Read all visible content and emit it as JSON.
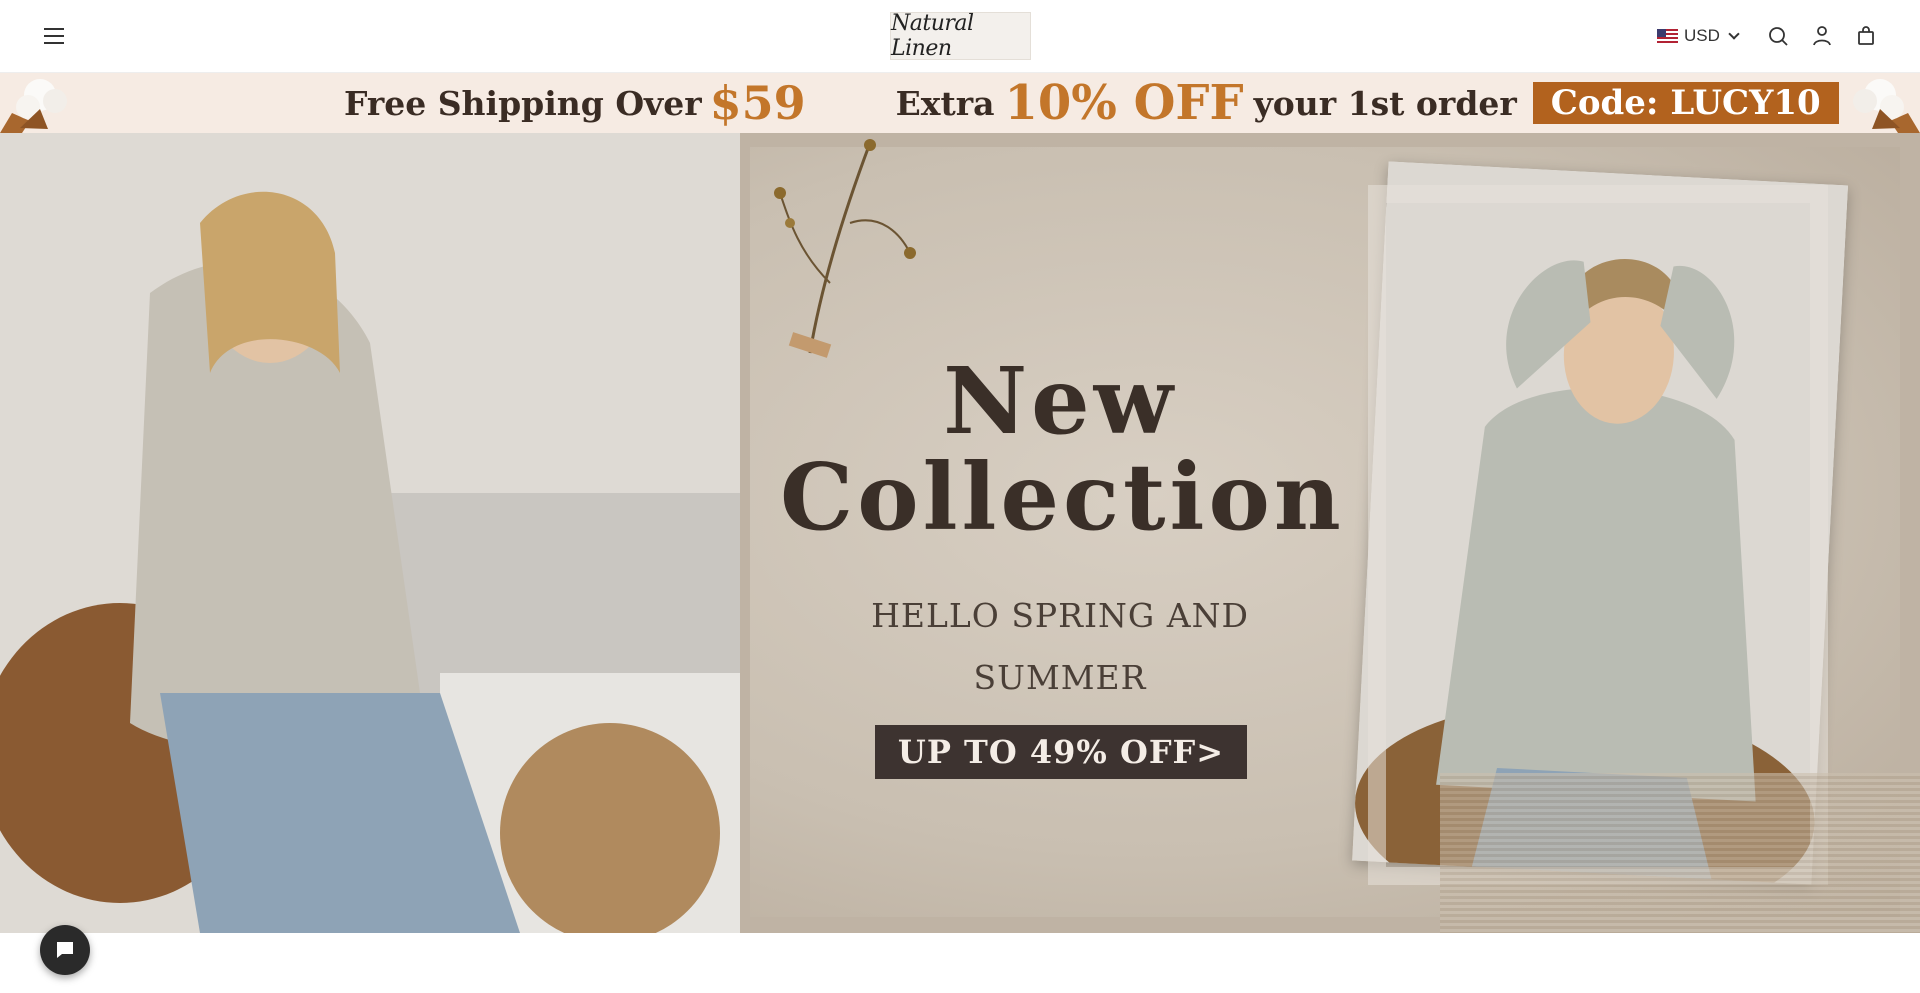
{
  "header": {
    "menu_icon": "hamburger-menu-icon",
    "logo_text": "Natural Linen",
    "currency": {
      "flag": "us-flag-icon",
      "label": "USD"
    },
    "icons": [
      "search-icon",
      "account-icon",
      "shopping-bag-icon"
    ]
  },
  "announcement": {
    "shipping_text": "Free Shipping Over",
    "shipping_amount": "$59",
    "extra_text": "Extra",
    "discount": "10% OFF",
    "order_text": "your 1st order",
    "code": "Code: LUCY10",
    "accent_color": "#c3762a",
    "code_bg": "#b2621e"
  },
  "hero": {
    "title_line1": "New",
    "title_line2": "Collection",
    "subtitle_line1": "HELLO SPRING AND",
    "subtitle_line2": "SUMMER",
    "cta": "UP TO 49% OFF>"
  },
  "chat": {
    "icon": "chat-bubble-icon"
  }
}
